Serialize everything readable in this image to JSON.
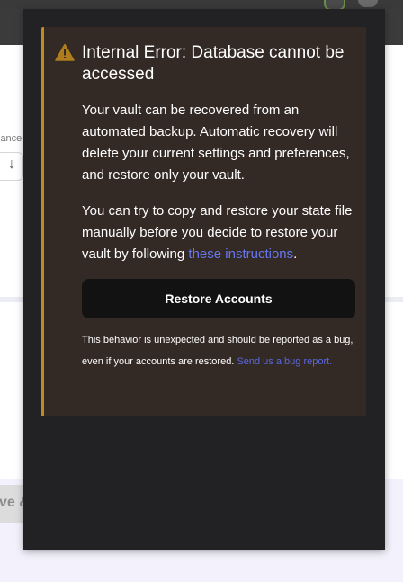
{
  "background": {
    "balance_fragment": "lance",
    "button_fragment": "ve &"
  },
  "error": {
    "title": "Internal Error: Database cannot be accessed",
    "paragraph1": "Your vault can be recovered from an automated backup. Automatic recovery will delete your current settings and preferences, and restore only your vault.",
    "paragraph2_prefix": "You can try to copy and restore your state file manually before you decide to restore your vault by following ",
    "paragraph2_link": "these instructions",
    "paragraph2_suffix": ".",
    "restore_button": "Restore Accounts",
    "footer_prefix": "This behavior is unexpected and should be reported as a bug, even if your accounts are restored. ",
    "footer_link": "Send us a bug report."
  },
  "colors": {
    "popup_bg": "#222224",
    "card_bg": "#332925",
    "warning_accent": "#c08b22",
    "link": "#6677ee",
    "button_bg": "#121212"
  },
  "icons": {
    "warning": "warning-triangle-icon",
    "arrow": "arrow-down-icon"
  }
}
